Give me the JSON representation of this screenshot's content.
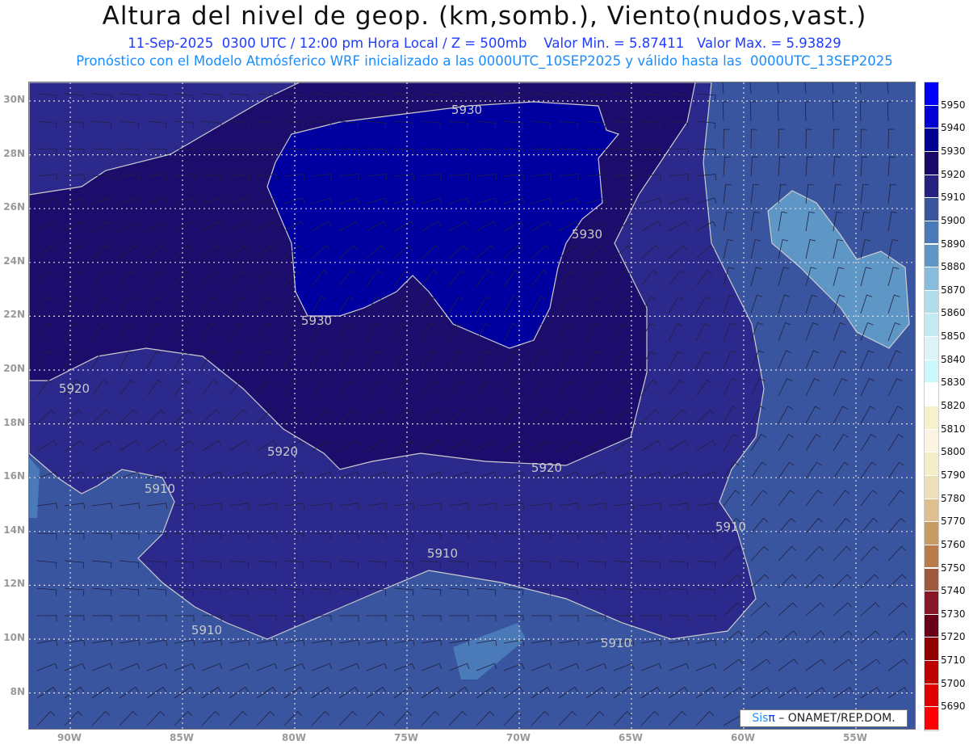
{
  "header": {
    "title": "Altura del nivel de geop. (km,somb.), Viento(nudos,vast.)",
    "subtitle": "11-Sep-2025  0300 UTC / 12:00 pm Hora Local / Z = 500mb    Valor Min. = 5.87411   Valor Max. = 5.93829",
    "info": "Pronóstico con el Modelo Atmósferico WRF inicializado a las 0000UTC_10SEP2025 y válido hasta las  0000UTC_13SEP2025"
  },
  "axes": {
    "lat_labels": [
      "30N",
      "28N",
      "26N",
      "24N",
      "22N",
      "20N",
      "18N",
      "16N",
      "14N",
      "12N",
      "10N",
      "8N"
    ],
    "lon_labels": [
      "90W",
      "85W",
      "80W",
      "75W",
      "70W",
      "65W",
      "60W",
      "55W"
    ]
  },
  "contour_labels": [
    "5930",
    "5930",
    "5930",
    "5920",
    "5920",
    "5920",
    "5910",
    "5910",
    "5910",
    "5910",
    "5910"
  ],
  "legend": {
    "labels": [
      "5950",
      "5940",
      "5930",
      "5920",
      "5910",
      "5900",
      "5890",
      "5880",
      "5870",
      "5860",
      "5850",
      "5840",
      "5830",
      "5820",
      "5810",
      "5800",
      "5790",
      "5780",
      "5770",
      "5760",
      "5750",
      "5740",
      "5730",
      "5720",
      "5710",
      "5700",
      "5690"
    ],
    "colors": [
      "#0000f8",
      "#0000d2",
      "#000090",
      "#1a0868",
      "#26207f",
      "#3a55a0",
      "#4a7ab8",
      "#5e96c6",
      "#88bcdc",
      "#b0dde9",
      "#c3eaf2",
      "#dcf4f7",
      "#cbf8f8",
      "#ffffff",
      "#f7f0cc",
      "#faf4e0",
      "#f5ecc8",
      "#ede0b8",
      "#dcc090",
      "#c89a64",
      "#b87c4c",
      "#a05840",
      "#881828",
      "#680018",
      "#900000",
      "#bc0000",
      "#de0000",
      "#ff0000"
    ]
  },
  "credit": {
    "sis": "Sis",
    "pi": "π",
    "rest": "– ONAMET/REP.DOM."
  }
}
